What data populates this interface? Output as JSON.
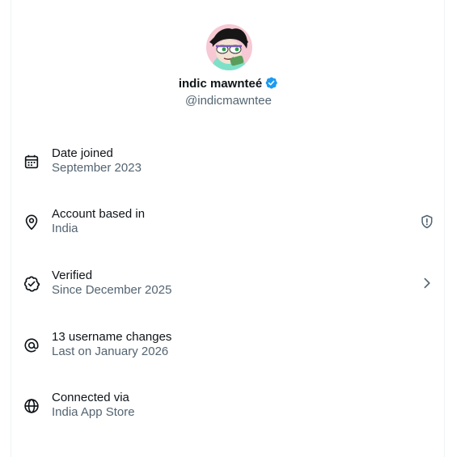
{
  "profile": {
    "display_name": "indic mawnteé",
    "handle": "@indicmawntee",
    "verified_icon": "verified-badge-icon"
  },
  "rows": [
    {
      "label": "Date joined",
      "value": "September 2023",
      "icon": "calendar-icon"
    },
    {
      "label": "Account based in",
      "value": "India",
      "icon": "location-pin-icon",
      "trail_icon": "shield-info-icon"
    },
    {
      "label": "Verified",
      "value": "Since December 2025",
      "icon": "verified-outline-icon",
      "trail_icon": "chevron-right-icon"
    },
    {
      "label": "13 username changes",
      "value": "Last on January 2026",
      "icon": "at-sign-icon"
    },
    {
      "label": "Connected via",
      "value": "India App Store",
      "icon": "globe-icon"
    }
  ],
  "colors": {
    "text_primary": "#0f1419",
    "text_secondary": "#536471",
    "verified_blue": "#1d9bf0",
    "divider": "#eff3f4"
  }
}
